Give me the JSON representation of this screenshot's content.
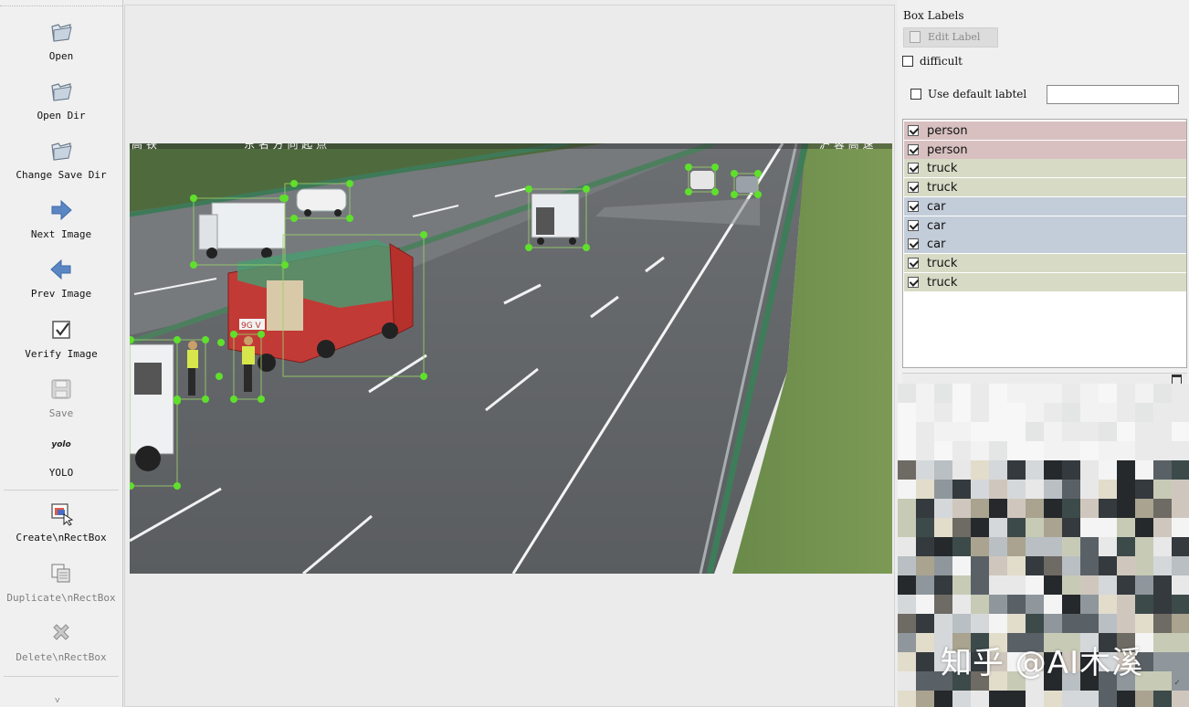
{
  "toolbar": {
    "open": "Open",
    "open_dir": "Open Dir",
    "change_save_dir": "Change Save Dir",
    "next_image": "Next Image",
    "prev_image": "Prev Image",
    "verify_image": "Verify Image",
    "save": "Save",
    "yolo_icon": "yolo",
    "yolo": "YOLO",
    "create_rect": "Create\\nRectBox",
    "duplicate_rect": "Duplicate\\nRectBox",
    "delete_rect": "Delete\\nRectBox",
    "more": "˅"
  },
  "canvas": {
    "overlay_text_left": "高 铁",
    "overlay_text_center": "东 名 方 向 起 点",
    "overlay_text_right": "沪 蓉 高 速",
    "truck_plate": "9G V"
  },
  "dock": {
    "title": "Box Labels",
    "edit_label": "Edit Label",
    "difficult": "difficult",
    "use_default": "Use default labtel",
    "default_value": "",
    "labels": [
      {
        "text": "person",
        "color": "#d8c0c0"
      },
      {
        "text": "person",
        "color": "#d8c0c0"
      },
      {
        "text": "truck",
        "color": "#d7dbc6"
      },
      {
        "text": "truck",
        "color": "#d7dbc6"
      },
      {
        "text": "car",
        "color": "#c3ccd9"
      },
      {
        "text": "car",
        "color": "#c3ccd9"
      },
      {
        "text": "car",
        "color": "#c3ccd9"
      },
      {
        "text": "truck",
        "color": "#d7dbc6"
      },
      {
        "text": "truck",
        "color": "#d7dbc6"
      }
    ]
  },
  "watermark": "知乎 @AI木溪",
  "colors": {
    "handle": "#5fe02c",
    "box": "#9ad06a"
  }
}
